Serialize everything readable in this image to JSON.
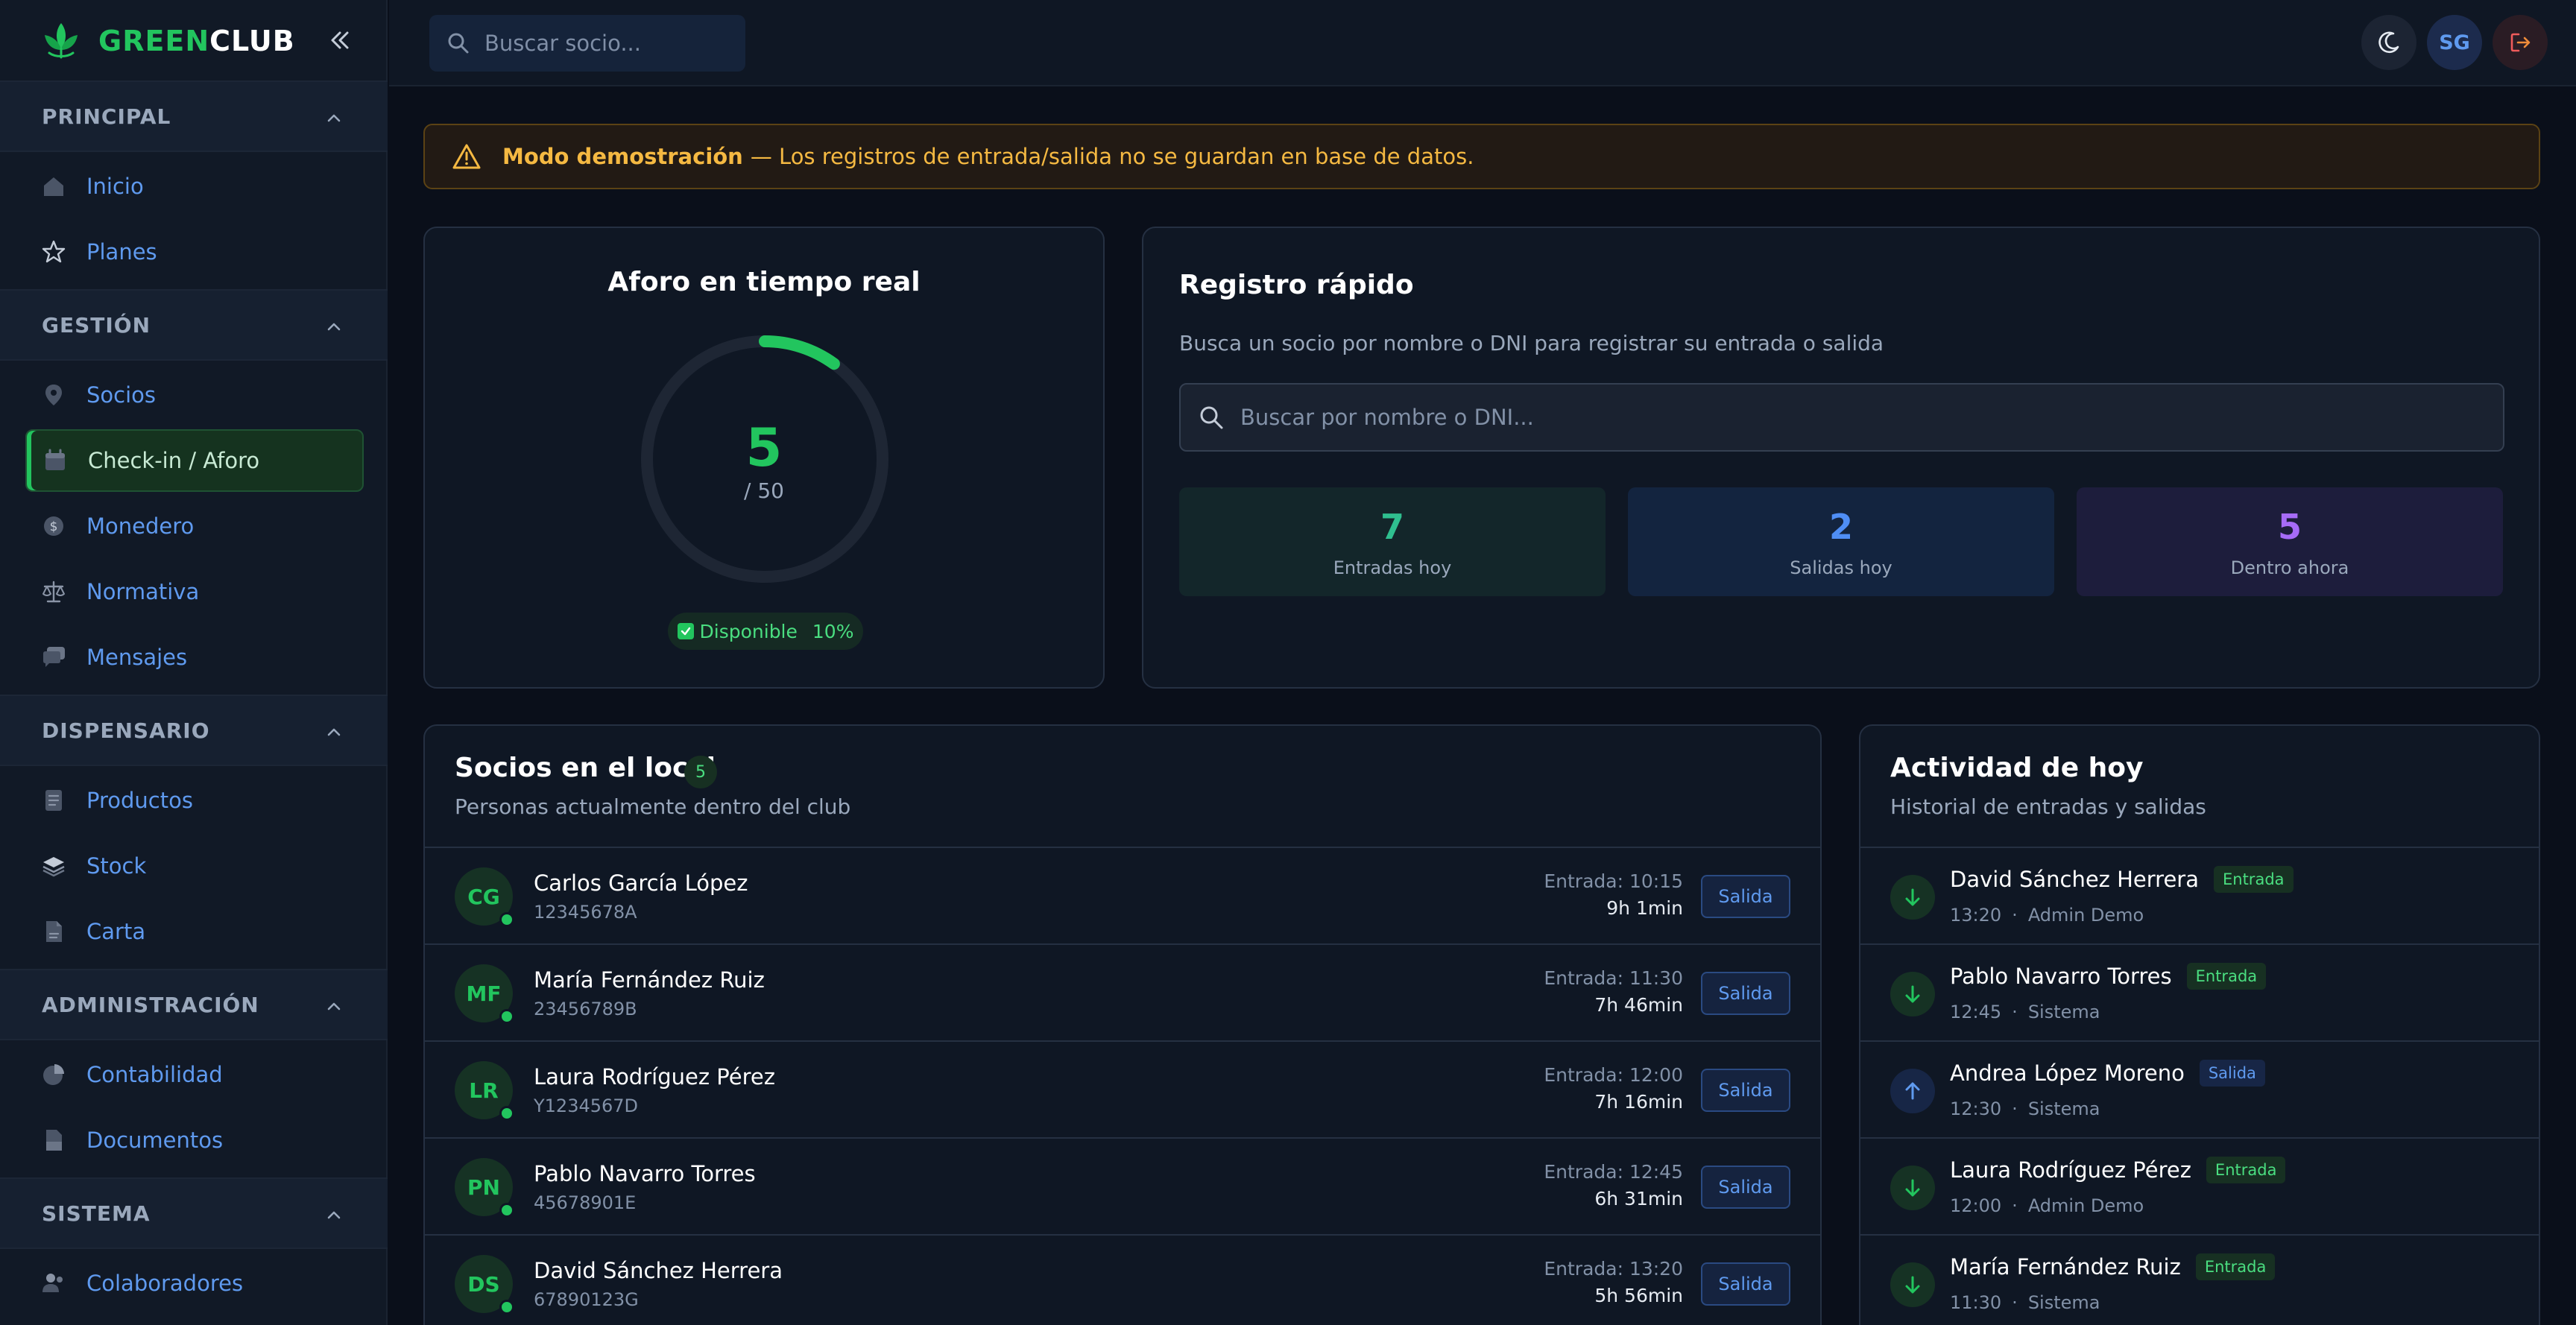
{
  "brand": {
    "prefix": "GREEN",
    "suffix": "CLUB"
  },
  "sidebar": {
    "sections": [
      {
        "label": "PRINCIPAL",
        "items": [
          {
            "label": "Inicio",
            "icon": "home-icon"
          },
          {
            "label": "Planes",
            "icon": "star-icon"
          }
        ]
      },
      {
        "label": "GESTIÓN",
        "items": [
          {
            "label": "Socios",
            "icon": "map-pin-icon"
          },
          {
            "label": "Check-in / Aforo",
            "icon": "calendar-icon",
            "active": true
          },
          {
            "label": "Monedero",
            "icon": "coin-icon"
          },
          {
            "label": "Normativa",
            "icon": "scale-icon"
          },
          {
            "label": "Mensajes",
            "icon": "chat-icon"
          }
        ]
      },
      {
        "label": "DISPENSARIO",
        "items": [
          {
            "label": "Productos",
            "icon": "document-icon"
          },
          {
            "label": "Stock",
            "icon": "layers-icon"
          },
          {
            "label": "Carta",
            "icon": "file-icon"
          }
        ]
      },
      {
        "label": "ADMINISTRACIÓN",
        "items": [
          {
            "label": "Contabilidad",
            "icon": "pie-chart-icon"
          },
          {
            "label": "Documentos",
            "icon": "folder-icon"
          }
        ]
      },
      {
        "label": "SISTEMA",
        "items": [
          {
            "label": "Colaboradores",
            "icon": "users-icon"
          }
        ]
      }
    ]
  },
  "topbar": {
    "search_placeholder": "Buscar socio...",
    "avatar_initials": "SG"
  },
  "banner": {
    "strong": "Modo demostración",
    "rest": "— Los registros de entrada/salida no se guardan en base de datos."
  },
  "aforo": {
    "title": "Aforo en tiempo real",
    "current": "5",
    "capacity_label": "/ 50",
    "capacity": 50,
    "occupancy_fraction": 0.1,
    "status": "Disponible",
    "percent": "10%"
  },
  "registro": {
    "title": "Registro rápido",
    "subtitle": "Busca un socio por nombre o DNI para registrar su entrada o salida",
    "search_placeholder": "Buscar por nombre o DNI...",
    "stats": {
      "entradas": {
        "value": "7",
        "label": "Entradas hoy"
      },
      "salidas": {
        "value": "2",
        "label": "Salidas hoy"
      },
      "dentro": {
        "value": "5",
        "label": "Dentro ahora"
      }
    }
  },
  "socios": {
    "title": "Socios en el local",
    "count": "5",
    "subtitle": "Personas actualmente dentro del club",
    "exit_label": "Salida",
    "rows": [
      {
        "initials": "CG",
        "name": "Carlos García López",
        "id": "12345678A",
        "entry": "Entrada: 10:15",
        "duration": "9h 1min"
      },
      {
        "initials": "MF",
        "name": "María Fernández Ruiz",
        "id": "23456789B",
        "entry": "Entrada: 11:30",
        "duration": "7h 46min"
      },
      {
        "initials": "LR",
        "name": "Laura Rodríguez Pérez",
        "id": "Y1234567D",
        "entry": "Entrada: 12:00",
        "duration": "7h 16min"
      },
      {
        "initials": "PN",
        "name": "Pablo Navarro Torres",
        "id": "45678901E",
        "entry": "Entrada: 12:45",
        "duration": "6h 31min"
      },
      {
        "initials": "DS",
        "name": "David Sánchez Herrera",
        "id": "67890123G",
        "entry": "Entrada: 13:20",
        "duration": "5h 56min"
      }
    ]
  },
  "actividad": {
    "title": "Actividad de hoy",
    "subtitle": "Historial de entradas y salidas",
    "rows": [
      {
        "name": "David Sánchez Herrera",
        "type": "in",
        "badge": "Entrada",
        "time": "13:20",
        "by": "Admin Demo"
      },
      {
        "name": "Pablo Navarro Torres",
        "type": "in",
        "badge": "Entrada",
        "time": "12:45",
        "by": "Sistema"
      },
      {
        "name": "Andrea López Moreno",
        "type": "out",
        "badge": "Salida",
        "time": "12:30",
        "by": "Sistema"
      },
      {
        "name": "Laura Rodríguez Pérez",
        "type": "in",
        "badge": "Entrada",
        "time": "12:00",
        "by": "Admin Demo"
      },
      {
        "name": "María Fernández Ruiz",
        "type": "in",
        "badge": "Entrada",
        "time": "11:30",
        "by": "Sistema"
      }
    ]
  },
  "colors": {
    "accent": "#22c55e",
    "link": "#5f9aef",
    "warning": "#f5b942",
    "purple": "#a66bf7"
  }
}
